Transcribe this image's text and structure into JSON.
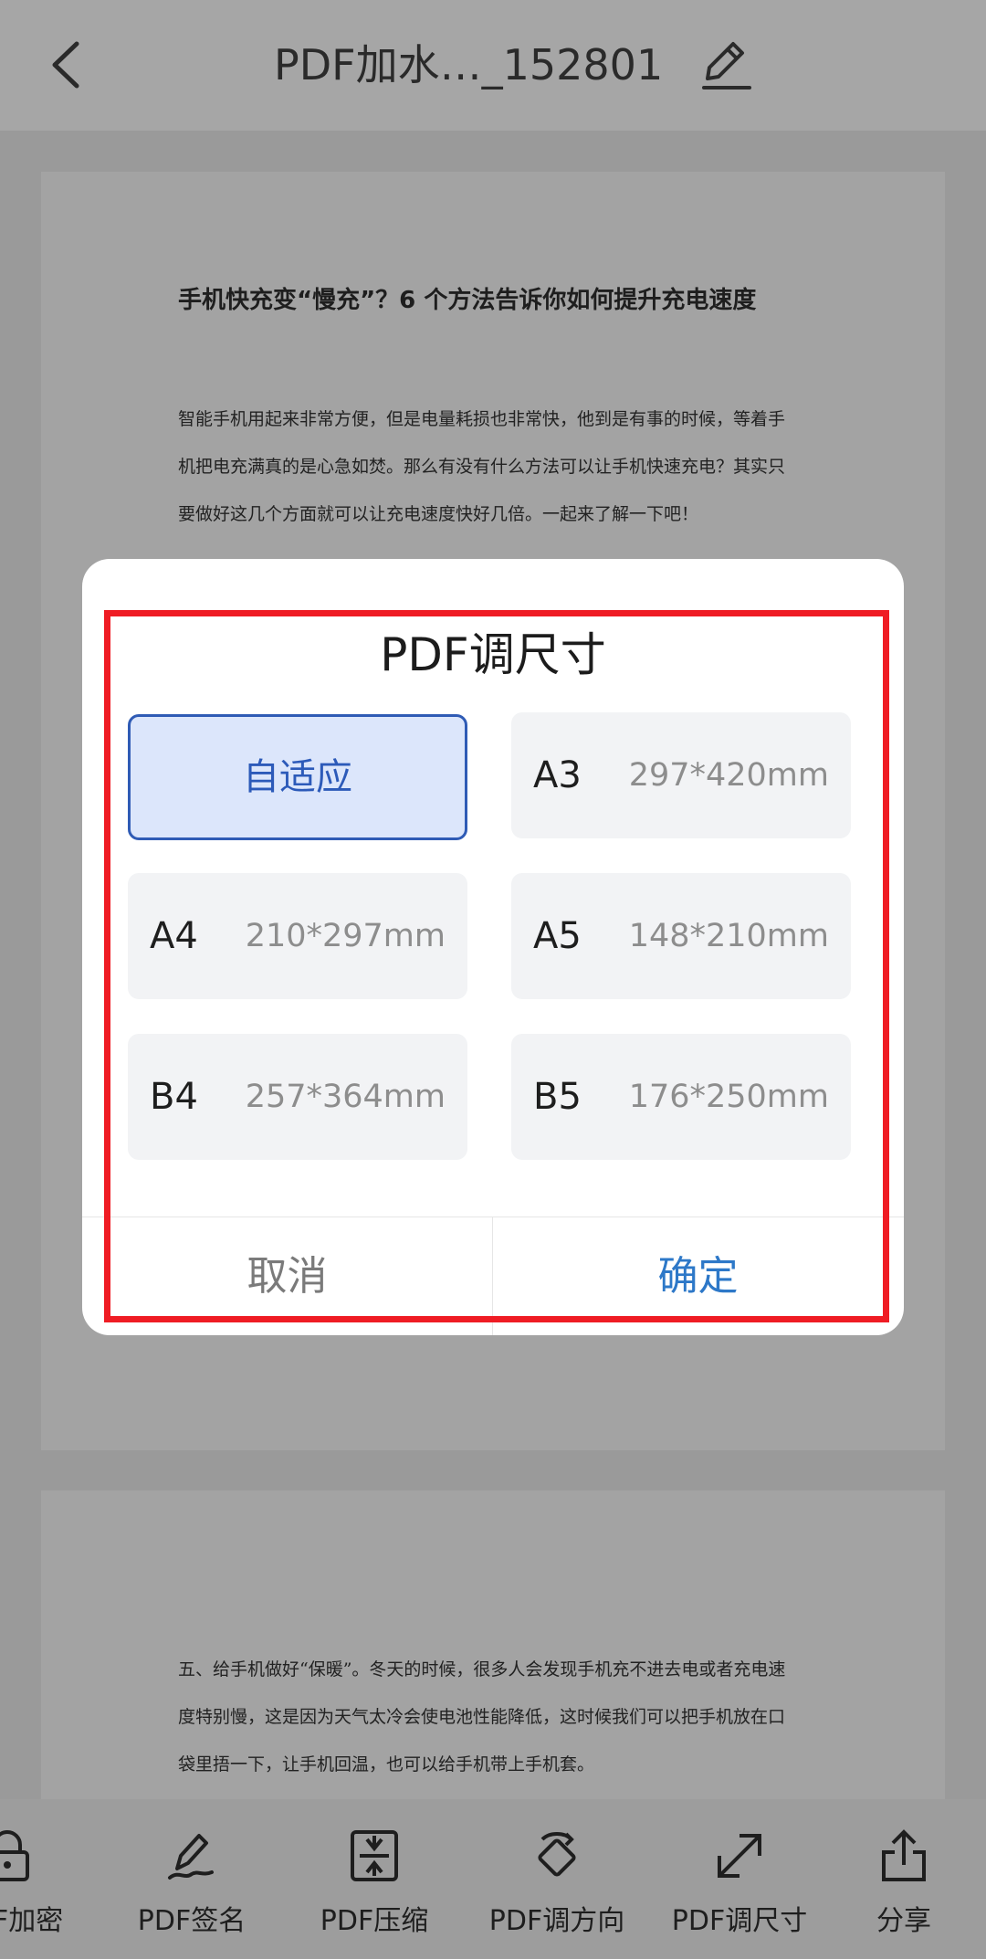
{
  "header": {
    "title": "PDF加水…_152801",
    "back_icon": "chevron-left-icon",
    "edit_icon": "pencil-icon"
  },
  "document": {
    "page1": {
      "heading": "手机快充变“慢充”？6 个方法告诉你如何提升充电速度",
      "paragraph_lines": [
        "智能手机用起来非常方便，但是电量耗损也非常快，他到是有事的时候，等着手",
        "机把电充满真的是心急如焚。那么有没有什么方法可以让手机快速充电？其实只",
        "要做好这几个方面就可以让充电速度快好几倍。一起来了解一下吧！"
      ]
    },
    "page2": {
      "paragraph_lines": [
        "五、给手机做好“保暖”。冬天的时候，很多人会发现手机充不进去电或者充电速",
        "度特别慢，这是因为天气太冷会使电池性能降低，这时候我们可以把手机放在口",
        "袋里捂一下，让手机回温，也可以给手机带上手机套。"
      ]
    }
  },
  "dialog": {
    "title": "PDF调尺寸",
    "options": [
      {
        "name": "自适应",
        "size": "",
        "selected": true
      },
      {
        "name": "A3",
        "size": "297*420mm",
        "selected": false
      },
      {
        "name": "A4",
        "size": "210*297mm",
        "selected": false
      },
      {
        "name": "A5",
        "size": "148*210mm",
        "selected": false
      },
      {
        "name": "B4",
        "size": "257*364mm",
        "selected": false
      },
      {
        "name": "B5",
        "size": "176*250mm",
        "selected": false
      }
    ],
    "cancel_label": "取消",
    "confirm_label": "确定"
  },
  "toolbar": {
    "items": [
      {
        "label": "PDF加密",
        "icon": "lock-icon"
      },
      {
        "label": "PDF签名",
        "icon": "signature-pen-icon"
      },
      {
        "label": "PDF压缩",
        "icon": "compress-icon"
      },
      {
        "label": "PDF调方向",
        "icon": "rotate-icon"
      },
      {
        "label": "PDF调尺寸",
        "icon": "resize-arrow-icon"
      },
      {
        "label": "分享",
        "icon": "share-icon"
      }
    ]
  },
  "colors": {
    "accent": "#2d78c8",
    "selected_border": "#2f5bb5",
    "selected_bg": "#dce6fb",
    "highlight_box": "#ef1c24",
    "overlay": "#9a9a9a"
  }
}
